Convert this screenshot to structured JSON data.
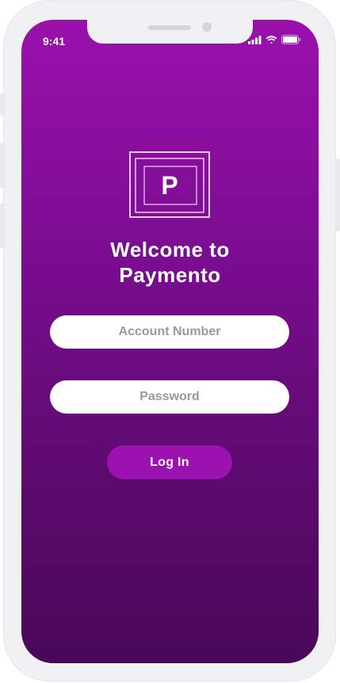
{
  "status_bar": {
    "time": "9:41"
  },
  "welcome": {
    "line1": "Welcome to",
    "line2": "Paymento"
  },
  "logo": {
    "letter": "P"
  },
  "form": {
    "account_placeholder": "Account Number",
    "password_placeholder": "Password",
    "login_label": "Log In"
  },
  "colors": {
    "gradient_top": "#9a10ad",
    "gradient_bottom": "#4a0859",
    "button": "#9b12b0",
    "input_bg": "#ffffff"
  }
}
